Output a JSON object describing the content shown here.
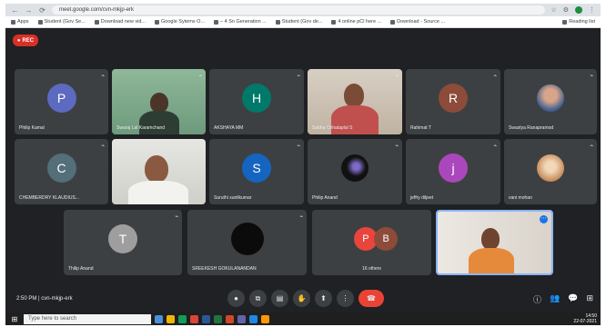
{
  "browser": {
    "url": "meet.google.com/cvn-mkjp-erk",
    "nav": [
      "←",
      "→",
      "⟳"
    ],
    "right_icons": [
      "☆",
      "⚙",
      "⋮"
    ],
    "bookmarks": [
      "Apps",
      "Student (Gov Se...",
      "Download new vid...",
      "Google Sytems O...",
      "– 4 Sn Generation ...",
      "Student (Gov de...",
      "4 online pCl here ...",
      "Download - Source ..."
    ],
    "bookmarks_right": "Reading list"
  },
  "recording": {
    "label": "REC"
  },
  "participants": [
    {
      "name": "Philip Kamal",
      "initial": "P",
      "color": "#5c6bc0",
      "type": "avatar"
    },
    {
      "name": "Swaraj Lal Karamchand",
      "type": "video",
      "scene": "green"
    },
    {
      "name": "AKSHAYA MM",
      "initial": "H",
      "color": "#00796b",
      "type": "avatar"
    },
    {
      "name": "Sabha Chhataplal S",
      "type": "video",
      "scene": "woman"
    },
    {
      "name": "Rahimat T",
      "initial": "R",
      "color": "#8d4b3a",
      "type": "avatar"
    },
    {
      "name": "Swastya Ranapramod",
      "type": "photo"
    },
    {
      "name": "CHEMBERDRY KLAUDIUS...",
      "initial": "C",
      "color": "#546e7a",
      "type": "avatar"
    },
    {
      "name": "",
      "type": "video",
      "scene": "man"
    },
    {
      "name": "Suruthi sunilkumar",
      "initial": "S",
      "color": "#1565c0",
      "type": "avatar"
    },
    {
      "name": "Philip Anand",
      "type": "photo-dark"
    },
    {
      "name": "jeffry diljeet",
      "initial": "j",
      "color": "#ab47bc",
      "type": "avatar"
    },
    {
      "name": "vani mohan",
      "type": "photo-light"
    },
    {
      "name": "Thilip Anand",
      "initial": "T",
      "color": "#9e9e9e",
      "type": "avatar"
    },
    {
      "name": "SREEKESH GOKULANANDAN",
      "type": "photo-black"
    },
    {
      "name": "16 others",
      "initial": "P",
      "initial2": "B",
      "color": "#e8453c",
      "color2": "#8d4b3a",
      "type": "group"
    },
    {
      "name": "",
      "type": "video",
      "scene": "presenter"
    }
  ],
  "meeting": {
    "time": "2:50 PM",
    "separator": "|",
    "code": "cvn-mkjp-erk"
  },
  "controls": [
    "mic-icon",
    "camera-icon",
    "captions-icon",
    "raise-hand-icon",
    "present-icon",
    "more-icon",
    "end-call-icon"
  ],
  "control_glyphs": [
    "●",
    "⧉",
    "▤",
    "✋",
    "⬆",
    "⋮",
    "☎"
  ],
  "right_controls": [
    "ⓘ",
    "👥",
    "💬",
    "⊞"
  ],
  "taskbar": {
    "search_placeholder": "Type here to search",
    "clock_time": "14:50",
    "clock_date": "22-07-2021"
  }
}
